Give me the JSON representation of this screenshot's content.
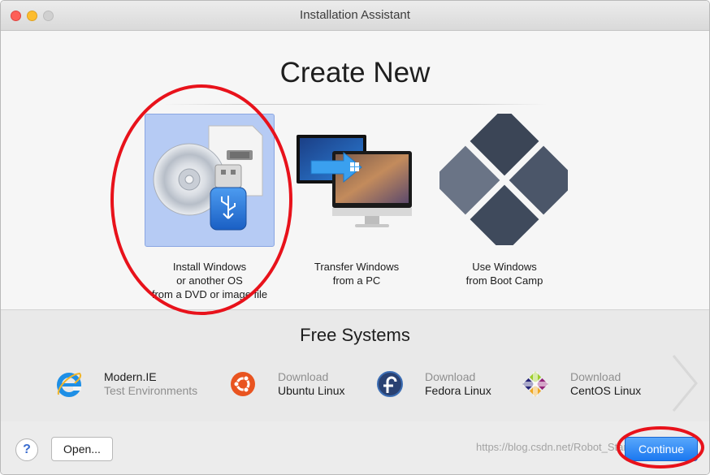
{
  "window": {
    "title": "Installation Assistant"
  },
  "create": {
    "title": "Create New",
    "options": [
      {
        "lines": [
          "Install Windows",
          "or another OS",
          "from a DVD or image file"
        ],
        "selected": true,
        "icon": "dvd-usb-icon"
      },
      {
        "lines": [
          "Transfer Windows",
          "from a PC"
        ],
        "selected": false,
        "icon": "transfer-pc-icon"
      },
      {
        "lines": [
          "Use Windows",
          "from Boot Camp"
        ],
        "selected": false,
        "icon": "boot-camp-icon"
      }
    ]
  },
  "free": {
    "title": "Free Systems",
    "items": [
      {
        "line1": "Modern.IE",
        "line2": "Test Environments",
        "icon": "internet-explorer-icon"
      },
      {
        "line1": "Download",
        "line2": "Ubuntu Linux",
        "icon": "ubuntu-icon"
      },
      {
        "line1": "Download",
        "line2": "Fedora Linux",
        "icon": "fedora-icon"
      },
      {
        "line1": "Download",
        "line2": "CentOS Linux",
        "icon": "centos-icon"
      }
    ]
  },
  "footer": {
    "help_label": "?",
    "open_label": "Open...",
    "continue_label": "Continue",
    "watermark": "https://blog.csdn.net/Robot_Starscream"
  },
  "colors": {
    "accent": "#1b78f0",
    "selection": "#b6cbf4",
    "annotation": "#e8121b"
  }
}
